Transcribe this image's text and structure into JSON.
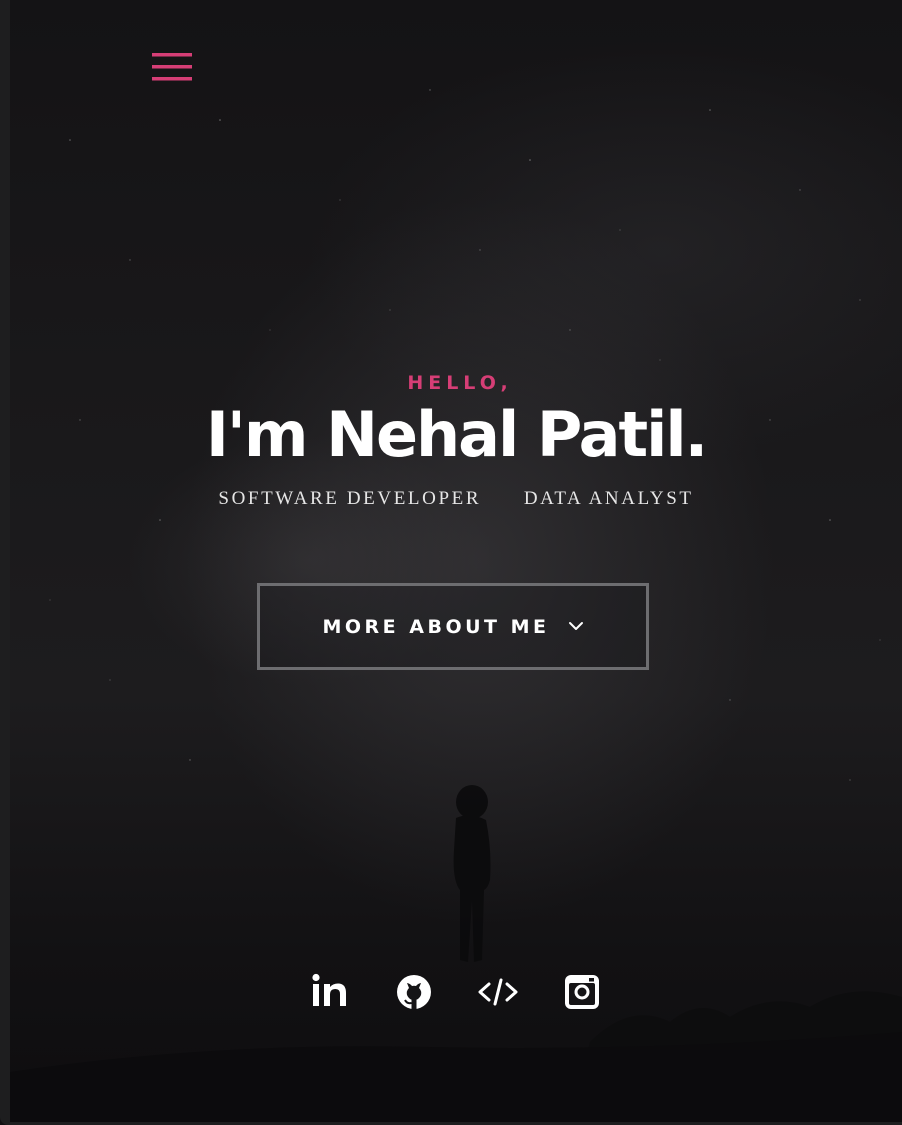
{
  "header": {
    "menu_icon": "hamburger-menu-icon",
    "accent_color": "#d63e76"
  },
  "intro": {
    "greeting": "HELLO,",
    "name": "I'm Nehal Patil.",
    "roles": [
      "SOFTWARE DEVELOPER",
      "DATA ANALYST"
    ]
  },
  "cta": {
    "label": "MORE ABOUT ME",
    "icon": "chevron-down-icon"
  },
  "social": [
    {
      "name": "linkedin",
      "icon": "linkedin-icon"
    },
    {
      "name": "github",
      "icon": "github-icon"
    },
    {
      "name": "code",
      "icon": "code-icon"
    },
    {
      "name": "instagram",
      "icon": "instagram-icon"
    }
  ],
  "colors": {
    "background": "#111012",
    "text": "#ffffff",
    "button_border": "#6d6d70"
  }
}
